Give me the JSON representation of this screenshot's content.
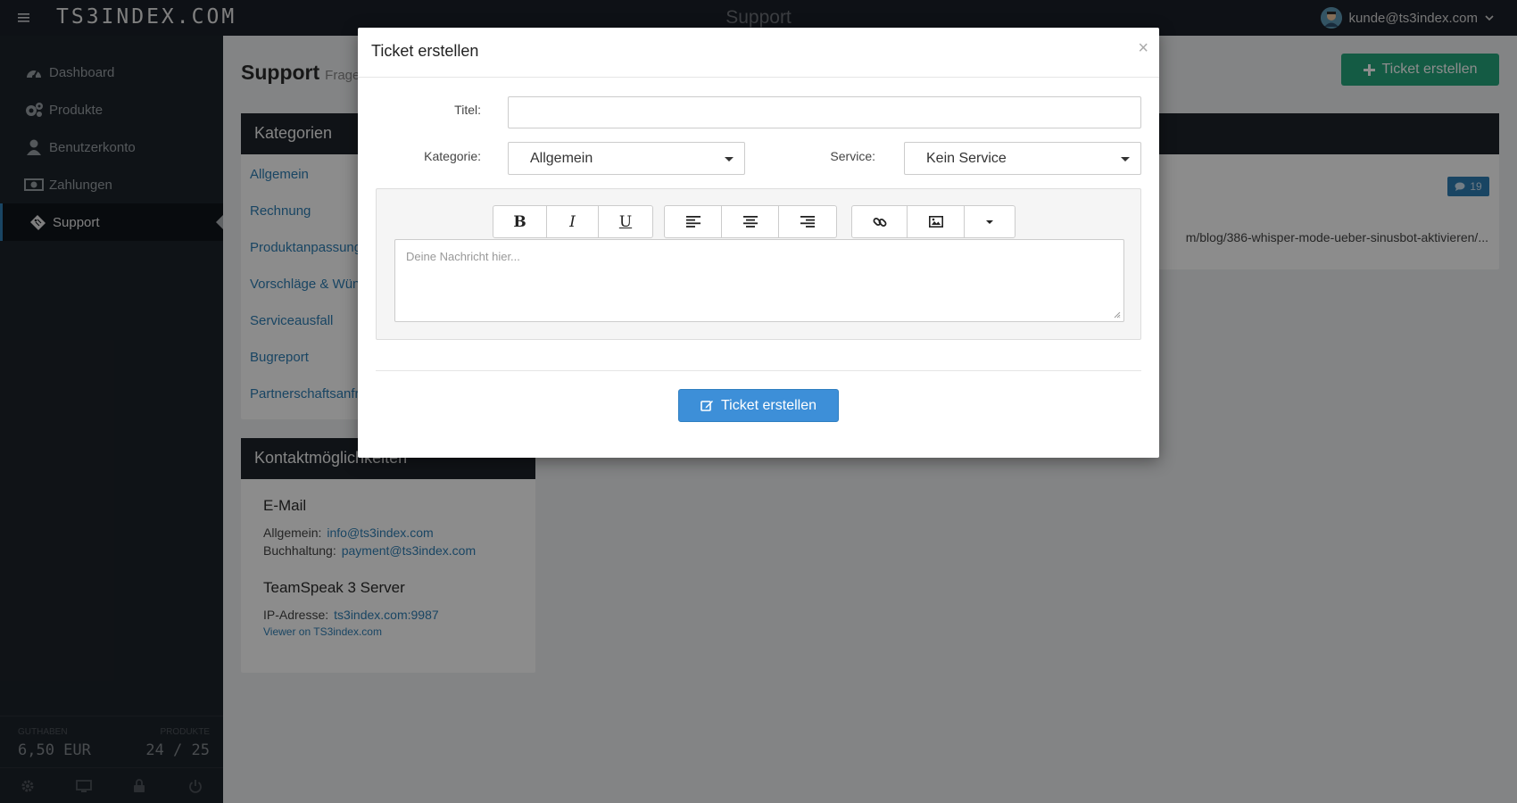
{
  "app": {
    "logo": "TS3INDEX.COM",
    "page_heading": "Support",
    "user_email": "kunde@ts3index.com"
  },
  "sidebar": {
    "items": [
      {
        "label": "Dashboard",
        "icon": "dashboard-icon"
      },
      {
        "label": "Produkte",
        "icon": "cogs-icon"
      },
      {
        "label": "Benutzerkonto",
        "icon": "user-icon"
      },
      {
        "label": "Zahlungen",
        "icon": "money-icon"
      },
      {
        "label": "Support",
        "icon": "ticket-icon",
        "active": true
      }
    ],
    "footer": {
      "credit_label": "Guthaben",
      "credit_value": "6,50 EUR",
      "products_label": "Produkte",
      "products_value": "24 / 25"
    }
  },
  "content": {
    "title": "Support",
    "subtitle": "Frage",
    "create_button": "Ticket erstellen",
    "categories": {
      "title": "Kategorien",
      "items": [
        "Allgemein",
        "Rechnung",
        "Produktanpassung",
        "Vorschläge & Wün",
        "Serviceausfall",
        "Bugreport",
        "Partnerschaftsanfr"
      ]
    },
    "contact": {
      "title": "Kontaktmöglichkeiten",
      "email_heading": "E-Mail",
      "general_label": "Allgemein:",
      "general_email": "info@ts3index.com",
      "billing_label": "Buchhaltung:",
      "billing_email": "payment@ts3index.com",
      "ts_heading": "TeamSpeak 3 Server",
      "ip_label": "IP-Adresse:",
      "ip_value": "ts3index.com:9987",
      "viewer_link": "Viewer on TS3index.com"
    },
    "ticket": {
      "comments": "19",
      "url": "m/blog/386-whisper-mode-ueber-sinusbot-aktivieren/..."
    }
  },
  "modal": {
    "title": "Ticket erstellen",
    "close": "×",
    "title_label": "Titel:",
    "title_value": "",
    "category_label": "Kategorie:",
    "category_value": "Allgemein",
    "service_label": "Service:",
    "service_value": "Kein Service",
    "message_placeholder": "Deine Nachricht hier...",
    "toolbar": {
      "bold": "B",
      "italic": "I",
      "underline": "U"
    },
    "submit": "Ticket erstellen"
  },
  "colors": {
    "accent_blue": "#3d8fd8",
    "accent_green": "#26a77d",
    "sidebar_bg": "#1d232a",
    "panel_header": "#1e242b"
  }
}
